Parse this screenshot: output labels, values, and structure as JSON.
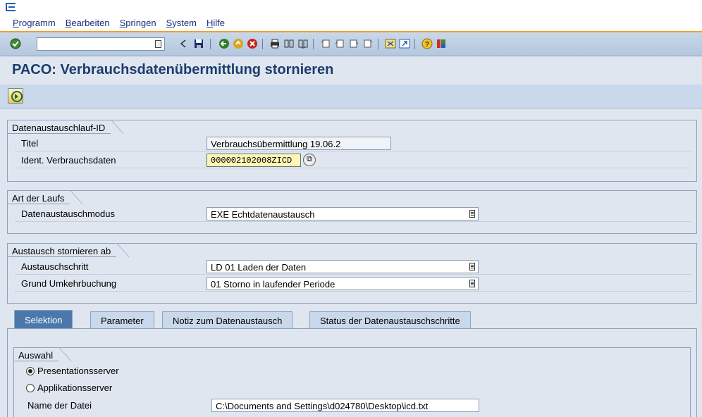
{
  "menu": [
    "Programm",
    "Bearbeiten",
    "Springen",
    "System",
    "Hilfe"
  ],
  "toolbar": {
    "command_value": "",
    "icons": [
      "enter-icon",
      "back-icon",
      "save-icon",
      "back-nav-icon",
      "exit-icon",
      "cancel-icon",
      "print-icon",
      "find-icon",
      "find-next-icon",
      "first-page-icon",
      "prev-page-icon",
      "next-page-icon",
      "last-page-icon",
      "new-session-icon",
      "shortcut-icon",
      "help-icon",
      "layout-icon"
    ]
  },
  "title": "PACO: Verbrauchsdatenübermittlung stornieren",
  "group1": {
    "title": "Datenaustauschlauf-ID",
    "titel_label": "Titel",
    "titel_value": "Verbrauchsübermittlung 19.06.2",
    "ident_label": "Ident. Verbrauchsdaten",
    "ident_value": "000002102008ZICD"
  },
  "group2": {
    "title": "Art der Laufs",
    "modus_label": "Datenaustauschmodus",
    "modus_value": "EXE Echtdatenaustausch"
  },
  "group3": {
    "title": "Austausch stornieren ab",
    "schritt_label": "Austauschschritt",
    "schritt_value": "LD 01 Laden der Daten",
    "grund_label": "Grund Umkehrbuchung",
    "grund_value": "01 Storno in laufender Periode"
  },
  "tabs": [
    "Selektion",
    "Parameter",
    "Notiz zum Datenaustausch",
    "Status der Datenaustauschschritte"
  ],
  "auswahl": {
    "title": "Auswahl",
    "radio1": "Presentationsserver",
    "radio2": "Applikationsserver",
    "datei_label": "Name der Datei",
    "datei_value": "C:\\Documents and Settings\\d024780\\Desktop\\icd.txt"
  }
}
